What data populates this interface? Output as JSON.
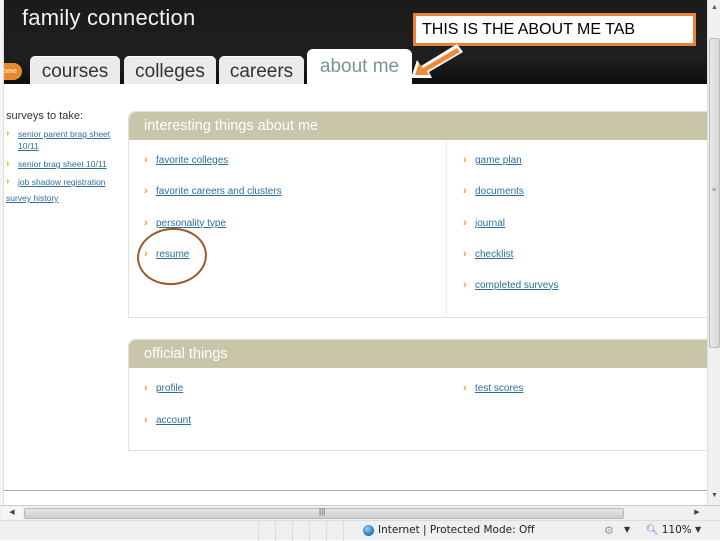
{
  "header": {
    "brand": "family connection",
    "home_label": "ome",
    "tabs": [
      {
        "label": "courses",
        "active": false
      },
      {
        "label": "colleges",
        "active": false
      },
      {
        "label": "careers",
        "active": false
      },
      {
        "label": "about me",
        "active": true
      }
    ]
  },
  "annotation": {
    "callout_text": "THIS IS THE ABOUT ME TAB",
    "callout_color": "#e8823c",
    "circle_color": "#9a5a2c",
    "circle_target": "resume"
  },
  "sidebar": {
    "title": "surveys to take:",
    "items": [
      {
        "label": "senior parent brag sheet 10/11"
      },
      {
        "label": "senior brag sheet 10/11"
      },
      {
        "label": "job shadow registration"
      }
    ],
    "history_link": "survey history"
  },
  "panels": {
    "interesting": {
      "title": "interesting things about me",
      "left": [
        {
          "label": "favorite colleges"
        },
        {
          "label": "favorite careers and clusters"
        },
        {
          "label": "personality type"
        },
        {
          "label": "resume"
        }
      ],
      "right": [
        {
          "label": "game plan"
        },
        {
          "label": "documents"
        },
        {
          "label": "journal"
        },
        {
          "label": "checklist"
        },
        {
          "label": "completed surveys"
        }
      ]
    },
    "official": {
      "title": "official things",
      "left": [
        {
          "label": "profile"
        },
        {
          "label": "account"
        }
      ],
      "right": [
        {
          "label": "test scores"
        }
      ]
    }
  },
  "statusbar": {
    "zone_text": "Internet | Protected Mode: Off",
    "zoom_level": "110%"
  },
  "colors": {
    "panel_header": "#c9c5a9",
    "link": "#2d6f96",
    "chevron": "#e8a21e",
    "home_tab": "#e88a2c",
    "active_tab_text": "#7a939c"
  }
}
